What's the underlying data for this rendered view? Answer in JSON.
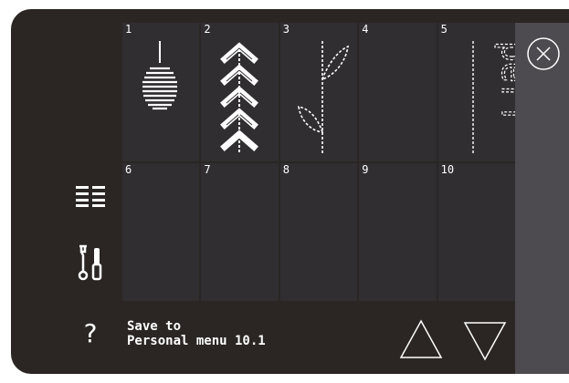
{
  "stitch_grid": {
    "cells": [
      {
        "number": "1",
        "pattern": "beaded-ball"
      },
      {
        "number": "2",
        "pattern": "chevron-arrows"
      },
      {
        "number": "3",
        "pattern": "leaf-stem"
      },
      {
        "number": "4",
        "pattern": "empty"
      },
      {
        "number": "5",
        "pattern": "perf-text"
      },
      {
        "number": "6",
        "pattern": "empty"
      },
      {
        "number": "7",
        "pattern": "empty"
      },
      {
        "number": "8",
        "pattern": "empty"
      },
      {
        "number": "9",
        "pattern": "empty"
      },
      {
        "number": "10",
        "pattern": "empty"
      }
    ],
    "perf_text": "perf"
  },
  "bottom_bar": {
    "save_line1": "Save to",
    "save_line2": "Personal menu 10.1"
  },
  "left_rail": {
    "icons": [
      "list-icon",
      "tools-icon",
      "help-icon"
    ],
    "help_glyph": "?"
  },
  "colors": {
    "screen_bg": "#2b2624",
    "cell_bg": "#302e31",
    "panel_bg": "#4d4b4f",
    "foreground": "#ffffff"
  }
}
